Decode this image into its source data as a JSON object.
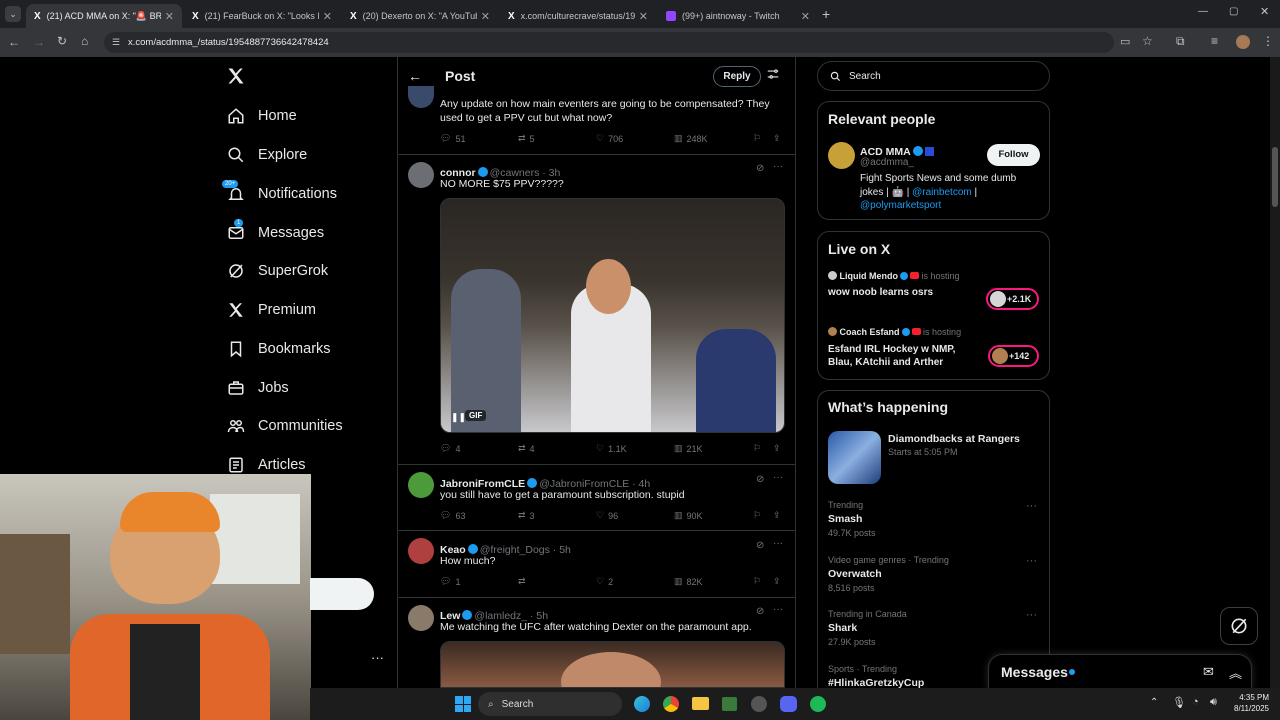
{
  "browser": {
    "tabs": [
      {
        "title": "(21) ACD MMA on X: \"🚨 BREA",
        "active": true
      },
      {
        "title": "(21) FearBuck on X: \"Looks like"
      },
      {
        "title": "(20) Dexerto on X: \"A YouTube"
      },
      {
        "title": "x.com/culturecrave/status/1954"
      },
      {
        "title": "(99+) aintnoway - Twitch"
      }
    ],
    "url": "x.com/acdmma_/status/1954887736642478424"
  },
  "nav": {
    "items": [
      {
        "label": "Home"
      },
      {
        "label": "Explore"
      },
      {
        "label": "Notifications",
        "badge": "20+"
      },
      {
        "label": "Messages",
        "badge": "1"
      },
      {
        "label": "SuperGrok"
      },
      {
        "label": "Premium"
      },
      {
        "label": "Bookmarks"
      },
      {
        "label": "Jobs"
      },
      {
        "label": "Communities"
      },
      {
        "label": "Articles"
      }
    ]
  },
  "header": {
    "title": "Post",
    "reply": "Reply"
  },
  "tweets": [
    {
      "text": "Any update on how main eventers are going to be compensated? They used to get a PPV cut but what now?",
      "replies": "51",
      "reposts": "5",
      "likes": "706",
      "views": "248K"
    },
    {
      "name": "connor",
      "handle": "@cawners · 3h",
      "text": "NO MORE $75 PPV?????",
      "gif": "GIF",
      "replies": "4",
      "reposts": "4",
      "likes": "1.1K",
      "views": "21K"
    },
    {
      "name": "JabroniFromCLE",
      "handle": "@JabroniFromCLE · 4h",
      "text": "you still have to get a paramount subscription. stupid",
      "replies": "63",
      "reposts": "3",
      "likes": "96",
      "views": "90K"
    },
    {
      "name": "Keao",
      "handle": "@freight_Dogs · 5h",
      "text": "How much?",
      "replies": "1",
      "reposts": "",
      "likes": "2",
      "views": "82K"
    },
    {
      "name": "Lew",
      "handle": "@lamledz_ · 5h",
      "text": "Me watching the UFC after watching Dexter on the paramount app."
    }
  ],
  "search": {
    "placeholder": "Search"
  },
  "relevant": {
    "title": "Relevant people",
    "name": "ACD MMA",
    "handle": "@acdmma_",
    "follow": "Follow",
    "bio": "Fight Sports News and some dumb jokes | 🤖 | ",
    "link1": "@rainbetcom",
    "bio_sep": " | ",
    "link2": "@polymarketsport"
  },
  "live": {
    "title": "Live on X",
    "items": [
      {
        "host": "Liquid Mendo",
        "status": "is hosting",
        "title": "wow noob learns osrs",
        "count": "+2.1K"
      },
      {
        "host": "Coach Esfand",
        "status": "is hosting",
        "title": "Esfand IRL Hockey w NMP, Blau, KAtchii and Arther",
        "count": "+142"
      }
    ]
  },
  "happening": {
    "title": "What’s happening",
    "event": {
      "title": "Diamondbacks at Rangers",
      "time": "Starts at 5:05 PM"
    },
    "trends": [
      {
        "context": "Trending",
        "name": "Smash",
        "posts": "49.7K posts"
      },
      {
        "context": "Video game genres · Trending",
        "name": "Overwatch",
        "posts": "8,516 posts"
      },
      {
        "context": "Trending in Canada",
        "name": "Shark",
        "posts": "27.9K posts"
      },
      {
        "context": "Sports · Trending",
        "name": "#HlinkaGretzkyCup",
        "posts": ""
      }
    ]
  },
  "messages_drawer": {
    "label": "Messages"
  },
  "taskbar": {
    "search": "Search",
    "time": "4:35 PM",
    "date": "8/11/2025"
  },
  "colors": {
    "accent": "#1d9bf0",
    "live": "#f91880",
    "bg": "#000000"
  }
}
